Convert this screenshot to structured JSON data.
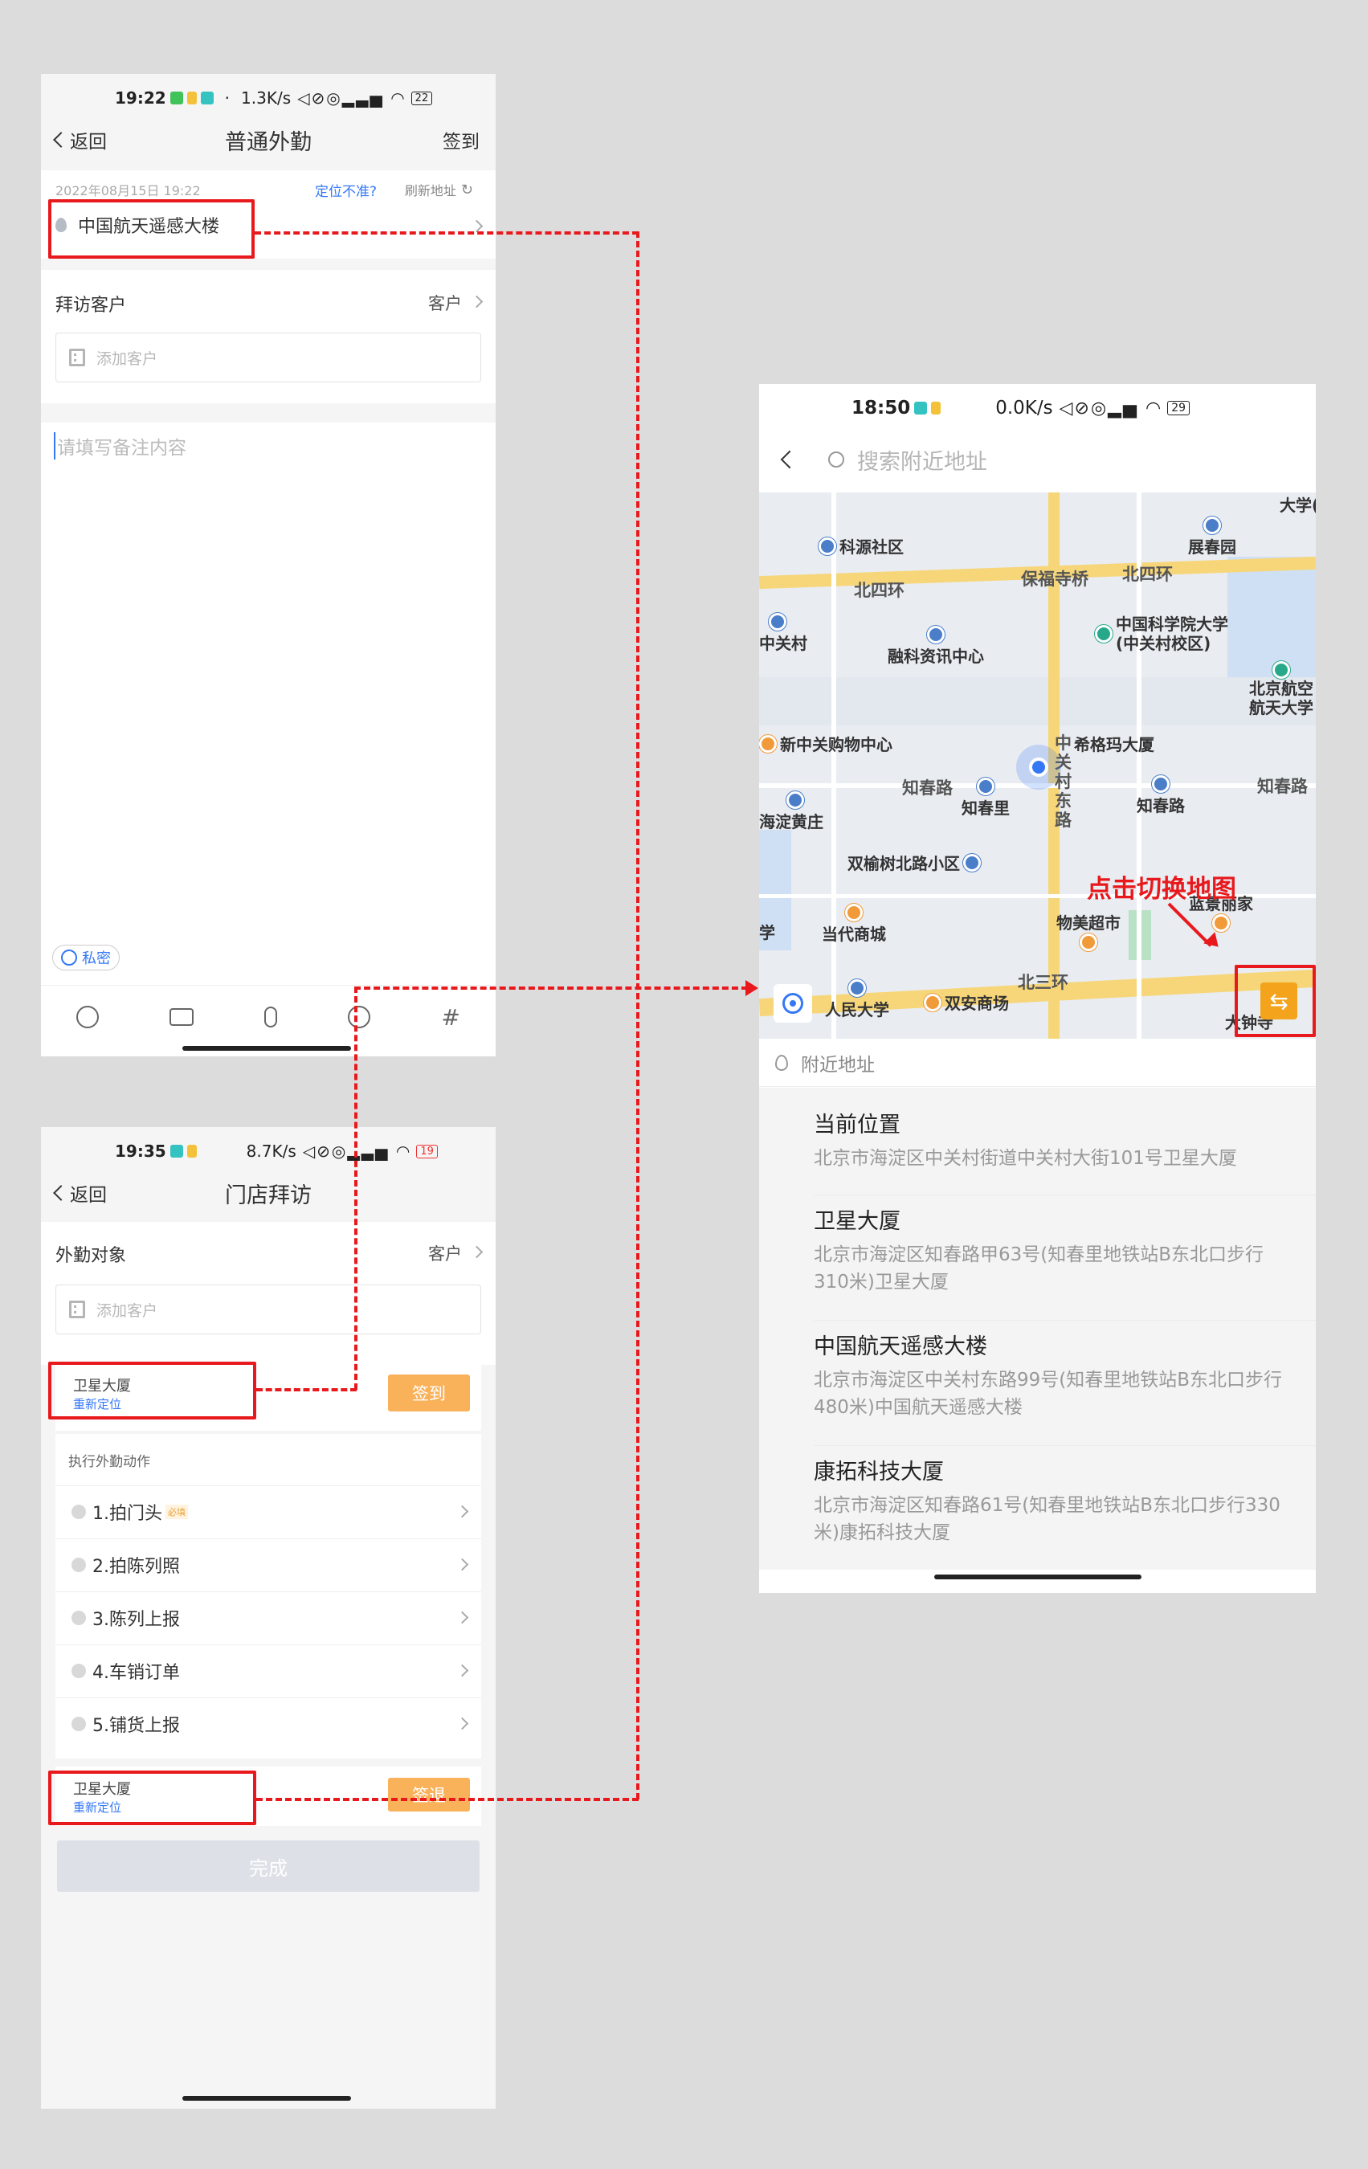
{
  "screen1": {
    "status": {
      "time": "19:22",
      "net": "1.3K/s",
      "battery": "22"
    },
    "nav": {
      "back": "返回",
      "title": "普通外勤",
      "right": "签到"
    },
    "datetime": "2022年08月15日 19:22",
    "location_hint": "定位不准?",
    "refresh": "刷新地址",
    "location": "中国航天遥感大楼",
    "visit_label": "拜访客户",
    "visit_value": "客户",
    "add_customer_placeholder": "添加客户",
    "note_placeholder": "请填写备注内容",
    "private_label": "私密",
    "toolbar_icons": [
      "smile-icon",
      "camera-icon",
      "mic-icon",
      "at-icon",
      "hash-icon"
    ],
    "hash": "#"
  },
  "screen2": {
    "status": {
      "time": "19:35",
      "net": "8.7K/s",
      "battery": "19"
    },
    "nav": {
      "back": "返回",
      "title": "门店拜访"
    },
    "target_label": "外勤对象",
    "target_value": "客户",
    "add_customer_placeholder": "添加客户",
    "checkin": {
      "place": "卫星大厦",
      "relocate": "重新定位",
      "button": "签到"
    },
    "actions_title": "执行外勤动作",
    "actions": [
      {
        "label": "1.拍门头",
        "tag": "必填"
      },
      {
        "label": "2.拍陈列照",
        "tag": ""
      },
      {
        "label": "3.陈列上报",
        "tag": ""
      },
      {
        "label": "4.车销订单",
        "tag": ""
      },
      {
        "label": "5.铺货上报",
        "tag": ""
      }
    ],
    "checkout": {
      "place": "卫星大厦",
      "relocate": "重新定位",
      "button": "签退"
    },
    "done": "完成"
  },
  "screen3": {
    "status": {
      "time": "18:50",
      "net": "0.0K/s",
      "battery": "29"
    },
    "search_placeholder": "搜索附近地址",
    "map": {
      "pois": [
        "科源社区",
        "展春园",
        "中关村",
        "融科资讯中心",
        "中国科学院大学",
        "(中关村校区)",
        "北京航空",
        "航天大学",
        "新中关购物中心",
        "希格玛大厦",
        "知春里",
        "知春路",
        "海淀黄庄",
        "双榆树北路小区",
        "当代商城",
        "物美超市",
        "蓝景丽家",
        "人民大学",
        "双安商场",
        "大学(",
        "学",
        "大钟寺"
      ],
      "roads": [
        "北四环",
        "保福寺桥",
        "北四环",
        "知春路",
        "中关村东路",
        "知春路",
        "北三环"
      ],
      "annotation": "点击切换地图",
      "switch_icon": "swap-icon"
    },
    "nearby_label": "附近地址",
    "addresses": [
      {
        "name": "当前位置",
        "addr": "北京市海淀区中关村街道中关村大街101号卫星大厦"
      },
      {
        "name": "卫星大厦",
        "addr": "北京市海淀区知春路甲63号(知春里地铁站B东北口步行310米)卫星大厦"
      },
      {
        "name": "中国航天遥感大楼",
        "addr": "北京市海淀区中关村东路99号(知春里地铁站B东北口步行480米)中国航天遥感大楼"
      },
      {
        "name": "康拓科技大厦",
        "addr": "北京市海淀区知春路61号(知春里地铁站B东北口步行330米)康拓科技大厦"
      }
    ]
  },
  "colors": {
    "red": "#e8191d",
    "orange": "#f9b15a",
    "blue": "#3478f6",
    "bg": "#dcdcdc"
  }
}
